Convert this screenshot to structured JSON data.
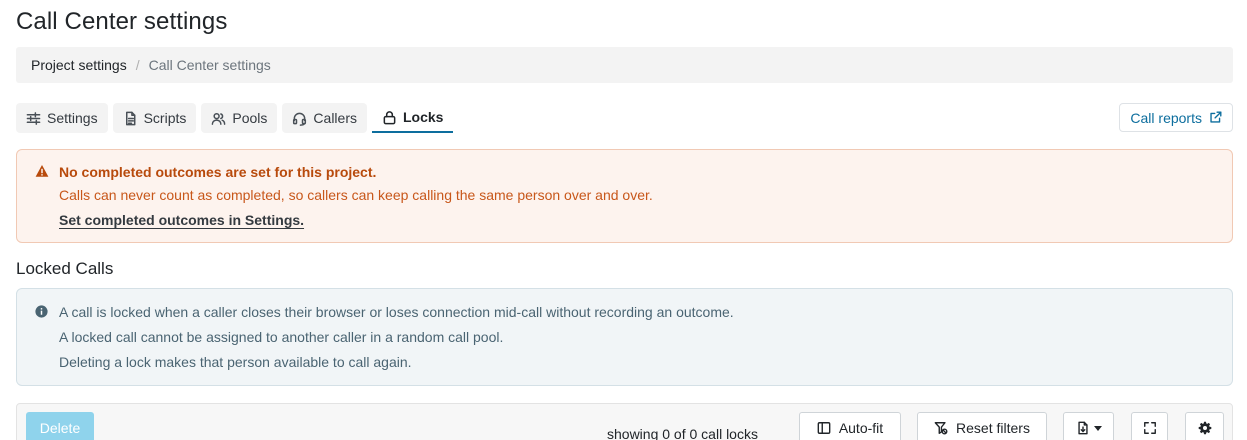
{
  "page": {
    "title": "Call Center settings"
  },
  "breadcrumb": {
    "parent": "Project settings",
    "separator": "/",
    "current": "Call Center settings"
  },
  "tabs": [
    {
      "label": "Settings",
      "icon": "sliders-icon",
      "active": false
    },
    {
      "label": "Scripts",
      "icon": "document-icon",
      "active": false
    },
    {
      "label": "Pools",
      "icon": "users-icon",
      "active": false
    },
    {
      "label": "Callers",
      "icon": "headset-icon",
      "active": false
    },
    {
      "label": "Locks",
      "icon": "lock-icon",
      "active": true
    }
  ],
  "call_reports": {
    "label": "Call reports",
    "icon": "external-link-icon"
  },
  "warning": {
    "title": "No completed outcomes are set for this project.",
    "text": "Calls can never count as completed, so callers can keep calling the same person over and over.",
    "link": "Set completed outcomes in Settings."
  },
  "section": {
    "title": "Locked Calls"
  },
  "info": {
    "line1": "A call is locked when a caller closes their browser or loses connection mid-call without recording an outcome.",
    "line2": "A locked call cannot be assigned to another caller in a random call pool.",
    "line3": "Deleting a lock makes that person available to call again."
  },
  "toolbar": {
    "delete_label": "Delete",
    "count_text": "showing 0 of 0 call locks",
    "autofit_label": "Auto-fit",
    "reset_filters_label": "Reset filters"
  },
  "colors": {
    "accent": "#0d6e9e",
    "warning_text": "#c8571a",
    "warning_bg": "#fdf3ee",
    "info_bg": "#f1f5f7",
    "delete_disabled": "#8fd3ec"
  }
}
